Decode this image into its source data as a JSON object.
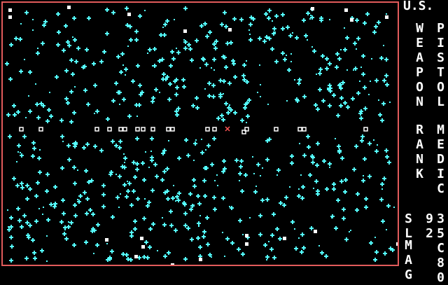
{
  "header": {
    "nation": "U.S."
  },
  "status": {
    "weapon_label": "WEAPON",
    "weapon_value": "PISTOL",
    "rank_label": "RANK",
    "rank_value": "MEDIC",
    "sl_label": "SL",
    "sl_value": "92",
    "mag_label": "MAG",
    "mag_value": "35C80"
  },
  "colors": {
    "border": "#e25b5b",
    "terrain": "#55ffff",
    "units": "#ffffff",
    "player": "#ff5555",
    "background": "#000000"
  }
}
